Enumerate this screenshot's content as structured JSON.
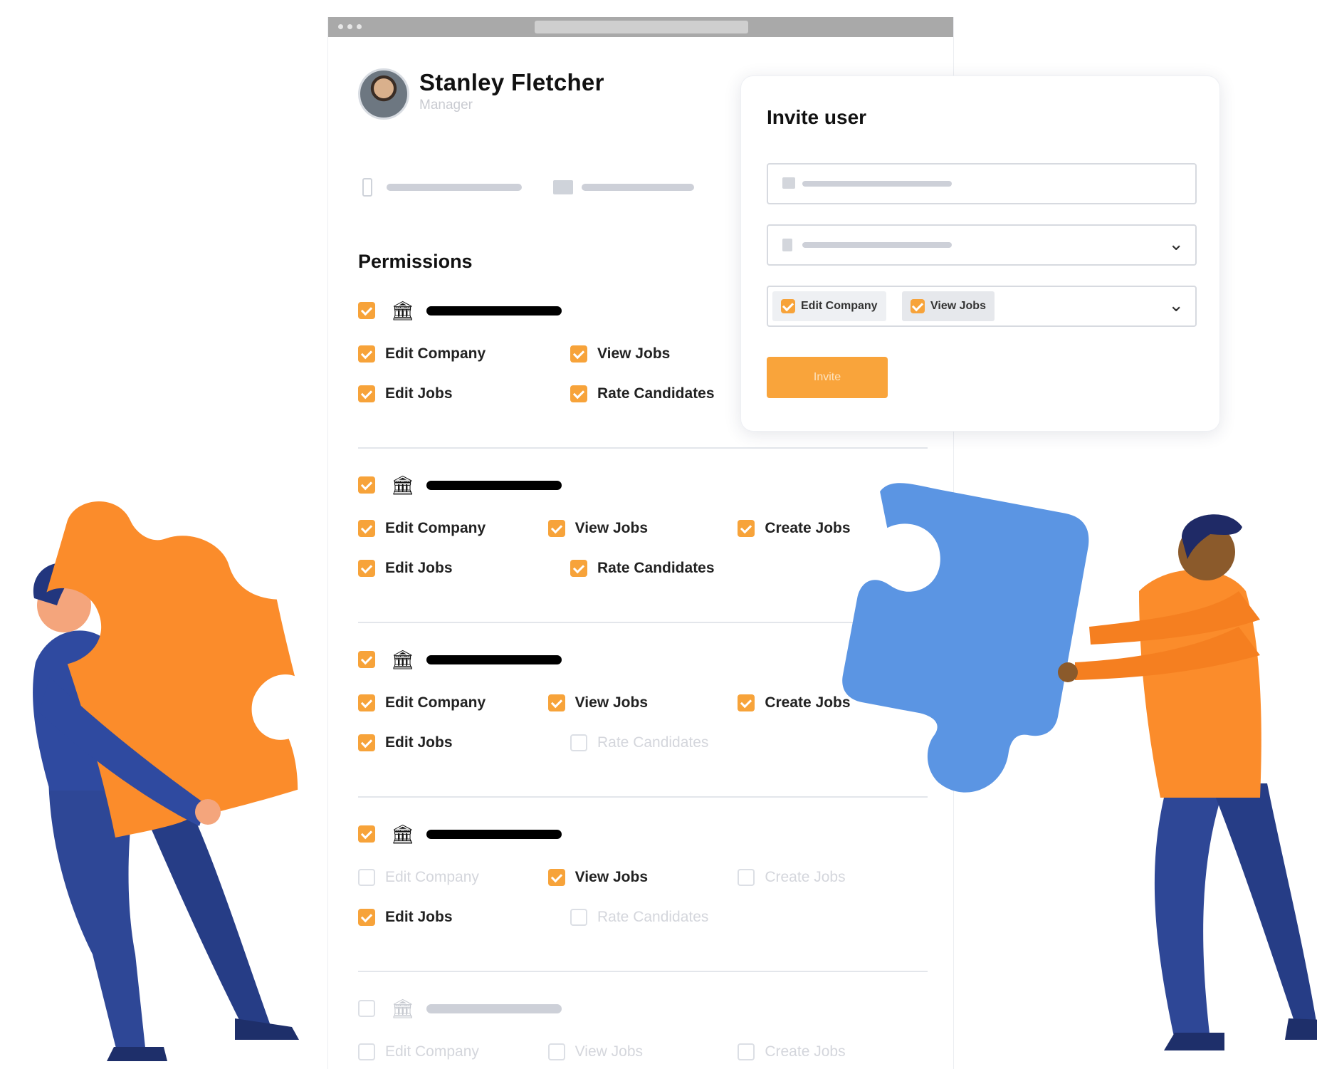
{
  "window": {
    "url": ""
  },
  "profile": {
    "name": "Stanley Fletcher",
    "role": "Manager"
  },
  "permissions": {
    "title": "Permissions",
    "groups": [
      {
        "checked": true,
        "active": true,
        "items": [
          {
            "label": "Edit Company",
            "checked": true
          },
          {
            "label": "View Jobs",
            "checked": true
          },
          {
            "label": "Edit Jobs",
            "checked": true
          },
          {
            "label": "Rate Candidates",
            "checked": true
          }
        ]
      },
      {
        "checked": true,
        "active": true,
        "items": [
          {
            "label": "Edit Company",
            "checked": true
          },
          {
            "label": "View Jobs",
            "checked": true
          },
          {
            "label": "Create Jobs",
            "checked": true
          },
          {
            "label": "Edit Jobs",
            "checked": true
          },
          {
            "label": "Rate Candidates",
            "checked": true
          }
        ]
      },
      {
        "checked": true,
        "active": true,
        "items": [
          {
            "label": "Edit Company",
            "checked": true
          },
          {
            "label": "View Jobs",
            "checked": true
          },
          {
            "label": "Create Jobs",
            "checked": true
          },
          {
            "label": "Edit Jobs",
            "checked": true
          },
          {
            "label": "Rate Candidates",
            "checked": false
          }
        ]
      },
      {
        "checked": true,
        "active": true,
        "items": [
          {
            "label": "Edit Company",
            "checked": false
          },
          {
            "label": "View Jobs",
            "checked": true
          },
          {
            "label": "Create Jobs",
            "checked": false
          },
          {
            "label": "Edit Jobs",
            "checked": true
          },
          {
            "label": "Rate Candidates",
            "checked": false
          }
        ]
      },
      {
        "checked": false,
        "active": false,
        "items": [
          {
            "label": "Edit Company",
            "checked": false
          },
          {
            "label": "View Jobs",
            "checked": false
          },
          {
            "label": "Create Jobs",
            "checked": false
          }
        ]
      }
    ]
  },
  "invite": {
    "title": "Invite user",
    "tags": [
      "Edit Company",
      "View Jobs"
    ],
    "button_label": "Invite"
  },
  "colors": {
    "accent": "#f7a33a",
    "puzzle_orange": "#fb8c2b",
    "puzzle_blue": "#5b95e3",
    "person_navy": "#2e4796"
  },
  "icons": [
    "phone-icon",
    "mail-icon",
    "bank-icon",
    "chevron-down-icon",
    "user-icon",
    "role-icon"
  ]
}
